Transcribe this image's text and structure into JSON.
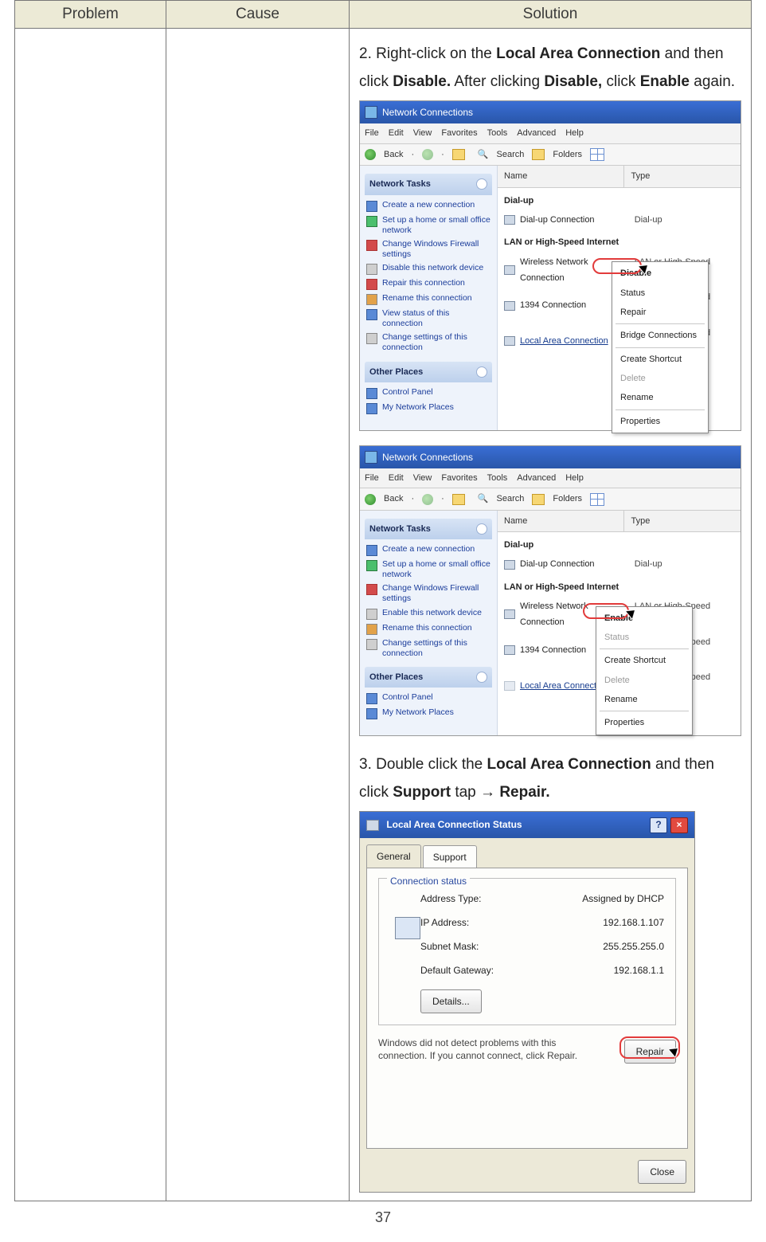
{
  "table": {
    "headers": {
      "problem": "Problem",
      "cause": "Cause",
      "solution": "Solution"
    }
  },
  "solution": {
    "s2_a": "2. Right-click on the ",
    "s2_b": "Local Area Connection",
    "s2_c": " and then click ",
    "s2_d": "Disable.",
    "s2_e": " After clicking ",
    "s2_f": "Disable,",
    "s2_g": " click ",
    "s2_h": "Enable",
    "s2_i": " again.",
    "s3_a": "3. Double click the ",
    "s3_b": "Local Area Connection",
    "s3_c": " and then click ",
    "s3_d": "Support",
    "s3_e": " tap → ",
    "s3_f": "Repair."
  },
  "netwin": {
    "title": "Network Connections",
    "menu": [
      "File",
      "Edit",
      "View",
      "Favorites",
      "Tools",
      "Advanced",
      "Help"
    ],
    "toolbar": {
      "back": "Back",
      "search": "Search",
      "folders": "Folders"
    },
    "cols": {
      "name": "Name",
      "type": "Type"
    },
    "side": {
      "tasks_hd": "Network Tasks",
      "tasks_disable": [
        "Create a new connection",
        "Set up a home or small office network",
        "Change Windows Firewall settings",
        "Disable this network device",
        "Repair this connection",
        "Rename this connection",
        "View status of this connection",
        "Change settings of this connection"
      ],
      "tasks_enable": [
        "Create a new connection",
        "Set up a home or small office network",
        "Change Windows Firewall settings",
        "Enable this network device",
        "Rename this connection",
        "Change settings of this connection"
      ],
      "other_hd": "Other Places",
      "other": [
        "Control Panel",
        "My Network Places"
      ]
    },
    "groups": {
      "dialup": "Dial-up",
      "lan": "LAN or High-Speed Internet"
    },
    "items": {
      "dial": {
        "name": "Dial-up Connection",
        "type": "Dial-up"
      },
      "wifi": {
        "name": "Wireless Network Connection",
        "type": "LAN or High-Speed Internet"
      },
      "n1394": {
        "name": "1394 Connection",
        "type": "LAN or High-Speed Internet"
      },
      "lac": {
        "name": "Local Area Connection",
        "type": "LAN or High-Speed Internet"
      }
    },
    "ctx_disable": {
      "i1": "Disable",
      "i2": "Status",
      "i3": "Repair",
      "i4": "Bridge Connections",
      "i5": "Create Shortcut",
      "i6": "Delete",
      "i7": "Rename",
      "i8": "Properties"
    },
    "ctx_enable": {
      "i1": "Enable",
      "i2": "Status",
      "i3": "Create Shortcut",
      "i4": "Delete",
      "i5": "Rename",
      "i6": "Properties"
    }
  },
  "dlg": {
    "title": "Local Area Connection Status",
    "help": "?",
    "close": "×",
    "tabs": {
      "general": "General",
      "support": "Support"
    },
    "group": "Connection status",
    "rows": {
      "r1k": "Address Type:",
      "r1v": "Assigned by DHCP",
      "r2k": "IP Address:",
      "r2v": "192.168.1.107",
      "r3k": "Subnet Mask:",
      "r3v": "255.255.255.0",
      "r4k": "Default Gateway:",
      "r4v": "192.168.1.1"
    },
    "details": "Details...",
    "note": "Windows did not detect problems with this connection. If you cannot connect, click Repair.",
    "repair": "Repair",
    "closebtn": "Close"
  },
  "page_number": "37"
}
